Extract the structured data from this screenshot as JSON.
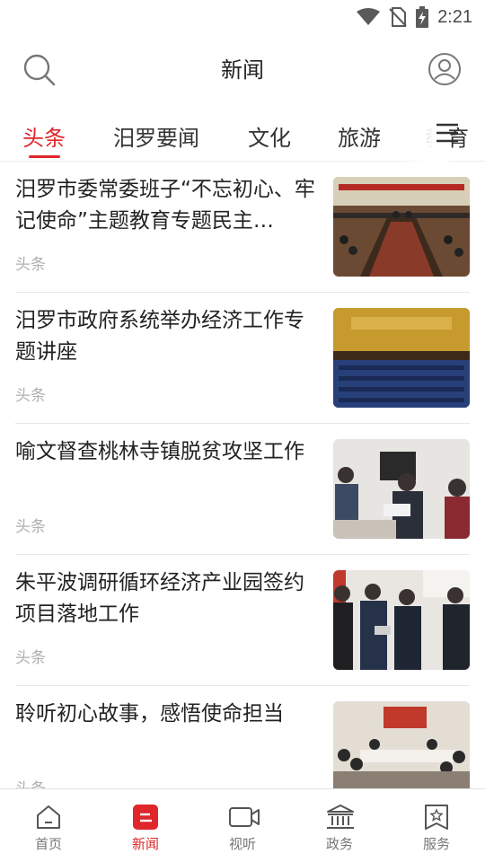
{
  "status_bar": {
    "time": "2:21"
  },
  "header": {
    "title": "新闻"
  },
  "tabs": [
    {
      "label": "头条",
      "active": true
    },
    {
      "label": "汨罗要闻",
      "active": false
    },
    {
      "label": "文化",
      "active": false
    },
    {
      "label": "旅游",
      "active": false
    },
    {
      "label": "教育",
      "active": false
    }
  ],
  "news": [
    {
      "title": "汨罗市委常委班子“不忘初心、牢记使命”主题教育专题民主…",
      "tag": "头条",
      "thumb": "meeting-room-photo"
    },
    {
      "title": "汨罗市政府系统举办经济工作专题讲座",
      "tag": "头条",
      "thumb": "auditorium-lecture-photo"
    },
    {
      "title": "喻文督查桃林寺镇脱贫攻坚工作",
      "tag": "头条",
      "thumb": "home-visit-photo"
    },
    {
      "title": "朱平波调研循环经济产业园签约项目落地工作",
      "tag": "头条",
      "thumb": "site-inspection-photo"
    },
    {
      "title": "聆听初心故事，感悟使命担当",
      "tag": "头条",
      "thumb": "conference-table-photo"
    }
  ],
  "bottom_nav": [
    {
      "label": "首页",
      "icon": "home-icon",
      "active": false
    },
    {
      "label": "新闻",
      "icon": "news-icon",
      "active": true
    },
    {
      "label": "视听",
      "icon": "video-camera-icon",
      "active": false
    },
    {
      "label": "政务",
      "icon": "government-building-icon",
      "active": false
    },
    {
      "label": "服务",
      "icon": "service-bookmark-icon",
      "active": false
    }
  ],
  "colors": {
    "accent": "#e0262b",
    "text": "#222222",
    "muted": "#b0b0b0"
  }
}
